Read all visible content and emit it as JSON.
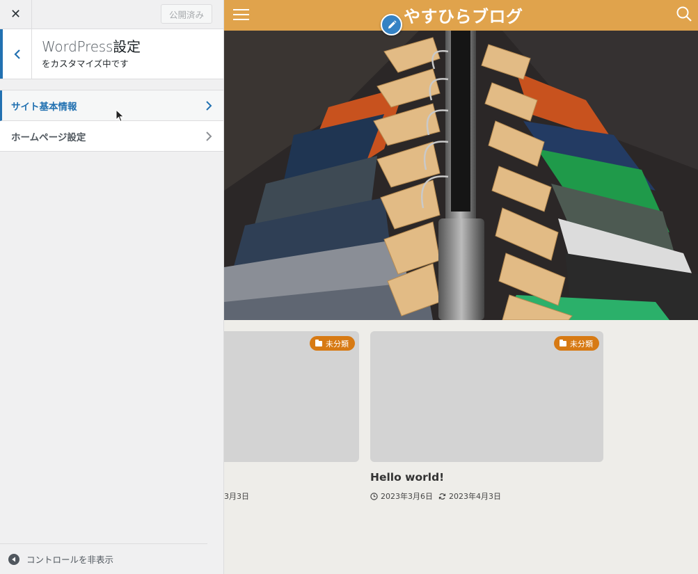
{
  "customizer": {
    "close_label": "✕",
    "publish_label": "公開済み",
    "panel_title_prefix": "WordPress",
    "panel_title_suffix": "設定",
    "panel_subtitle": "をカスタマイズ中です",
    "sections": [
      {
        "label": "サイト基本情報"
      },
      {
        "label": "ホームページ設定"
      }
    ],
    "collapse_label": "コントロールを非表示"
  },
  "site": {
    "title": "やすひらブログ",
    "header_color": "#e0a34c",
    "badge_color": "#d77a14"
  },
  "posts": [
    {
      "category": "未分類",
      "date_fragment": "3月3日"
    },
    {
      "category": "未分類",
      "title": "Hello world!",
      "published": "2023年3月6日",
      "updated": "2023年4月3日"
    }
  ]
}
